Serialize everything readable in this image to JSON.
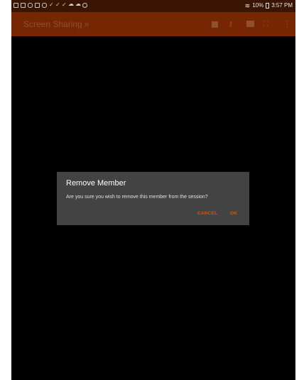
{
  "status_bar": {
    "battery": "10%",
    "time": "3:57 PM",
    "left_icons": [
      "file-icon",
      "image-icon",
      "phone-icon",
      "mail-icon",
      "camera-icon",
      "check-icon",
      "check-icon",
      "check-icon",
      "cloud-icon",
      "cloud-icon",
      "settings-icon"
    ]
  },
  "app_bar": {
    "title": "Screen Sharing",
    "title_chevron": "»",
    "background": "#772603",
    "actions": [
      "stop-icon",
      "key-icon",
      "keyboard-icon",
      "fullscreen-icon",
      "overflow-menu-icon"
    ]
  },
  "dialog": {
    "title": "Remove Member",
    "message": "Are you sure you wish to remove this member from the session?",
    "cancel_label": "CANCEL",
    "ok_label": "OK",
    "accent": "#e65100"
  }
}
